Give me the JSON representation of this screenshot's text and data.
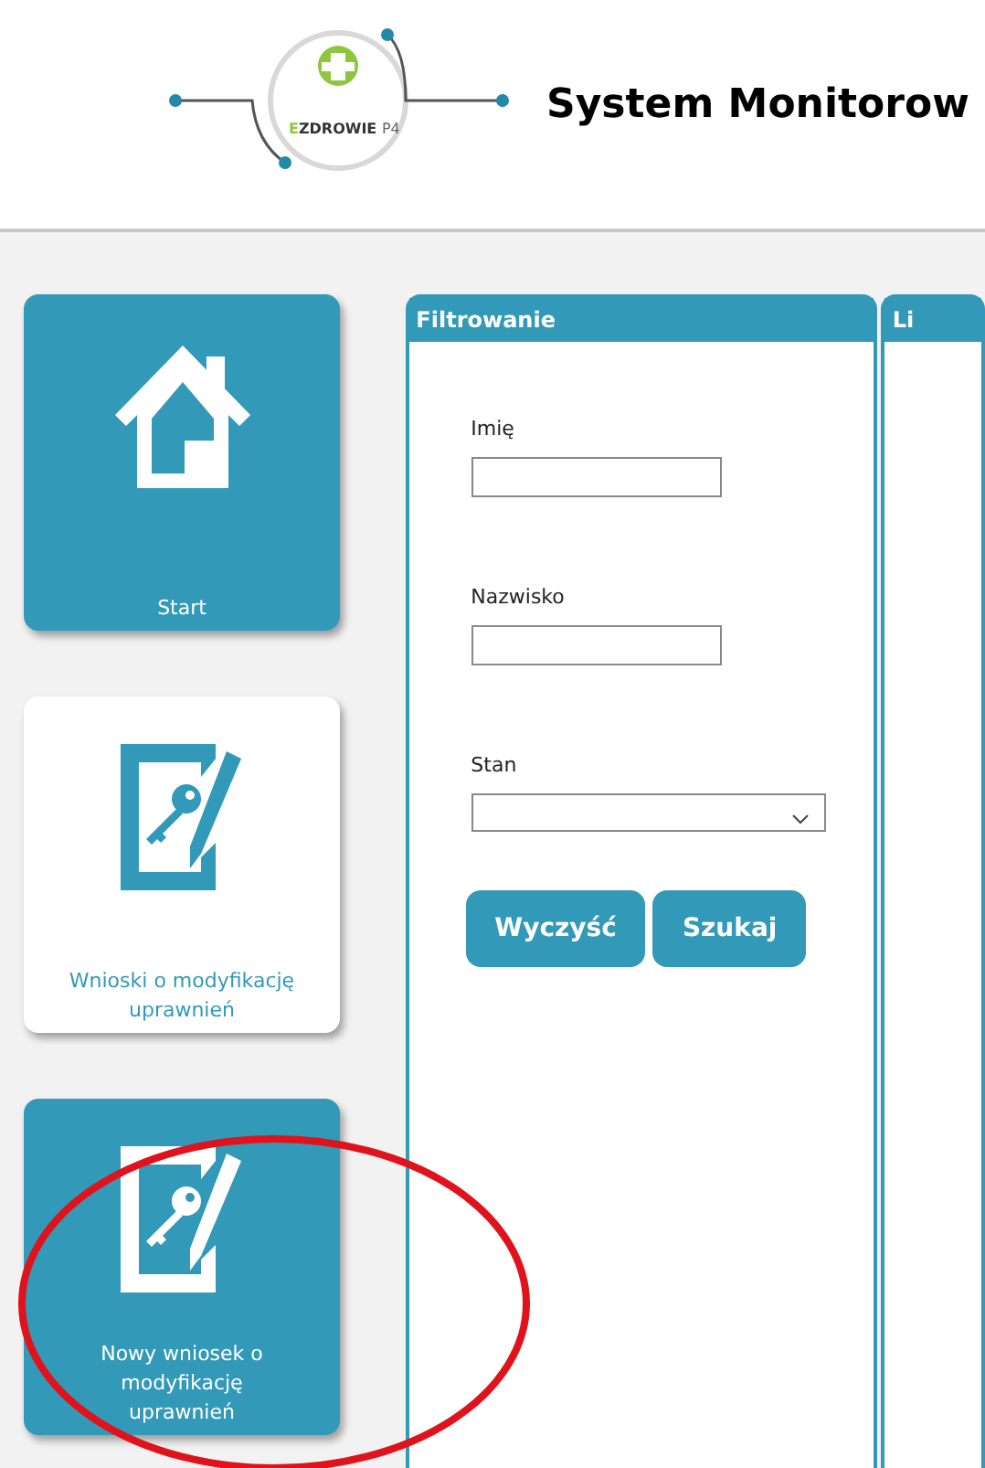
{
  "header": {
    "logo": {
      "accent": "E",
      "text": "ZDROWIE",
      "suffix": "P4"
    },
    "title": "System Monitorow"
  },
  "tiles": [
    {
      "label": "Start",
      "kind": "house",
      "selected": false
    },
    {
      "label": "Wnioski o modyfikację uprawnień",
      "kind": "request",
      "selected": true
    },
    {
      "label": "Nowy wniosek o modyfikację uprawnień",
      "kind": "request",
      "selected": false
    }
  ],
  "filter_panel": {
    "title": "Filtrowanie",
    "fields": [
      {
        "kind": "text",
        "label": "Imię"
      },
      {
        "kind": "text",
        "label": "Nazwisko"
      },
      {
        "kind": "select",
        "label": "Stan"
      }
    ],
    "buttons": [
      "Wyczyść",
      "Szukaj"
    ]
  },
  "list_panel": {
    "title": "Li"
  }
}
